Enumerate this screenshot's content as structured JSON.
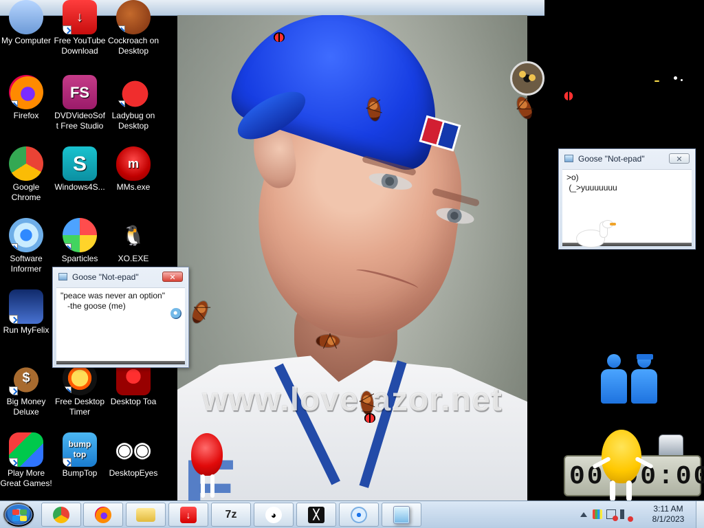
{
  "desktop": {
    "icons": [
      {
        "id": "my-computer",
        "label": "My Computer",
        "icon": "computer-icon",
        "glyph": ""
      },
      {
        "id": "free-youtube-download",
        "label": "Free YouTube Download",
        "icon": "download-icon",
        "glyph": "↓"
      },
      {
        "id": "cockroach-on-desktop",
        "label": "Cockroach on Desktop",
        "icon": "cockroach-icon",
        "glyph": ""
      },
      {
        "id": "firefox",
        "label": "Firefox",
        "icon": "firefox-icon",
        "glyph": ""
      },
      {
        "id": "dvdvideosoft-free-studio",
        "label": "DVDVideoSoft Free Studio",
        "icon": "dvdvideosoft-icon",
        "glyph": "FS"
      },
      {
        "id": "ladybug-on-desktop",
        "label": "Ladybug on Desktop",
        "icon": "ladybug-icon",
        "glyph": ""
      },
      {
        "id": "google-chrome",
        "label": "Google Chrome",
        "icon": "chrome-icon",
        "glyph": ""
      },
      {
        "id": "windows4s",
        "label": "Windows4S...",
        "icon": "windows4s-icon",
        "glyph": "S"
      },
      {
        "id": "mms-exe",
        "label": "MMs.exe",
        "icon": "mms-icon",
        "glyph": "m"
      },
      {
        "id": "software-informer",
        "label": "Software Informer",
        "icon": "software-informer-icon",
        "glyph": ""
      },
      {
        "id": "sparticles",
        "label": "Sparticles",
        "icon": "sparticles-icon",
        "glyph": ""
      },
      {
        "id": "xo-exe",
        "label": "XO.EXE",
        "icon": "xo-icon",
        "glyph": "🐧"
      },
      {
        "id": "run-myfelix",
        "label": "Run MyFelix",
        "icon": "myfelix-icon",
        "glyph": ""
      },
      {
        "id": "big-money-deluxe",
        "label": "Big Money Deluxe",
        "icon": "money-bag-icon",
        "glyph": "$"
      },
      {
        "id": "free-desktop-timer",
        "label": "Free Desktop Timer",
        "icon": "timer-icon",
        "glyph": ""
      },
      {
        "id": "desktop-toad",
        "label": "Desktop Toa",
        "icon": "toad-icon",
        "glyph": ""
      },
      {
        "id": "play-more-great-games",
        "label": "Play More Great Games!",
        "icon": "games-icon",
        "glyph": ""
      },
      {
        "id": "bumptop",
        "label": "BumpTop",
        "icon": "bumptop-icon",
        "glyph": "bump top"
      },
      {
        "id": "desktop-eyes",
        "label": "DesktopEyes",
        "icon": "eyes-icon",
        "glyph": "◉◉"
      }
    ],
    "wallpaper": {
      "watermark": "www.loverazor.net"
    },
    "notepad_left": {
      "title": "Goose \"Not-epad\"",
      "close_label": "✕",
      "content": "\"peace was never an option\"\n   -the goose (me)"
    },
    "notepad_right": {
      "title": "Goose \"Not-epad\"",
      "close_label": "✕",
      "content": ">o)\n (_>yuuuuuuu"
    },
    "timer": {
      "display": "00:00:00"
    }
  },
  "taskbar": {
    "buttons": [
      {
        "id": "chrome",
        "icon": "chrome-icon",
        "label": ""
      },
      {
        "id": "firefox",
        "icon": "firefox-icon",
        "label": ""
      },
      {
        "id": "file-explorer",
        "icon": "folder-icon",
        "label": ""
      },
      {
        "id": "download",
        "icon": "download-icon",
        "label": ""
      },
      {
        "id": "seven-zip",
        "icon": "7z-icon",
        "label": "7z"
      },
      {
        "id": "badtz-maru",
        "icon": "badtz-maru-icon",
        "label": ""
      },
      {
        "id": "lightsaber",
        "icon": "lightsaber-icon",
        "label": ""
      },
      {
        "id": "search-app",
        "icon": "search-icon",
        "label": ""
      },
      {
        "id": "notepad",
        "icon": "notepad-icon",
        "label": ""
      }
    ],
    "clock": {
      "time": "3:11 AM",
      "date": "8/1/2023"
    }
  }
}
